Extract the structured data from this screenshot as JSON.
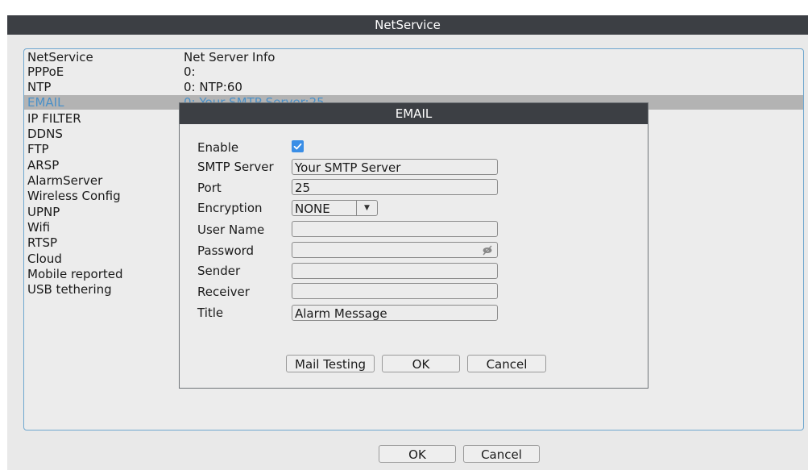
{
  "window": {
    "title": "NetService"
  },
  "list": {
    "headers": [
      "NetService",
      "Net Server Info"
    ],
    "rows": [
      {
        "name": "PPPoE",
        "info": "0:"
      },
      {
        "name": "NTP",
        "info": "0: NTP:60"
      },
      {
        "name": "EMAIL",
        "info": "0: Your SMTP Server:25",
        "selected": true
      },
      {
        "name": "IP FILTER",
        "info": ""
      },
      {
        "name": "DDNS",
        "info": ""
      },
      {
        "name": "FTP",
        "info": ""
      },
      {
        "name": "ARSP",
        "info": ""
      },
      {
        "name": "AlarmServer",
        "info": ""
      },
      {
        "name": "Wireless Config",
        "info": ""
      },
      {
        "name": "UPNP",
        "info": ""
      },
      {
        "name": "Wifi",
        "info": ""
      },
      {
        "name": "RTSP",
        "info": ""
      },
      {
        "name": "Cloud",
        "info": ""
      },
      {
        "name": "Mobile reported",
        "info": ""
      },
      {
        "name": "USB tethering",
        "info": ""
      }
    ]
  },
  "dialog": {
    "title": "EMAIL",
    "labels": {
      "enable": "Enable",
      "smtp_server": "SMTP Server",
      "port": "Port",
      "encryption": "Encryption",
      "user_name": "User Name",
      "password": "Password",
      "sender": "Sender",
      "receiver": "Receiver",
      "title": "Title"
    },
    "values": {
      "enable": true,
      "smtp_server": "Your SMTP Server",
      "port": "25",
      "encryption": "NONE",
      "user_name": "",
      "password": "",
      "sender": "",
      "receiver": "",
      "title": "Alarm Message"
    },
    "icons": {
      "checkbox": "checkmark-icon",
      "encryption_dropdown": "chevron-down-icon",
      "password_visibility": "eye-slash-icon"
    },
    "buttons": {
      "mail_testing": "Mail Testing",
      "ok": "OK",
      "cancel": "Cancel"
    }
  },
  "footer": {
    "ok": "OK",
    "cancel": "Cancel"
  },
  "colors": {
    "titlebar": "#3c3f44",
    "accent": "#3a8ee6",
    "selection": "#b3b3b3",
    "panel_border": "#6fa7cf"
  }
}
